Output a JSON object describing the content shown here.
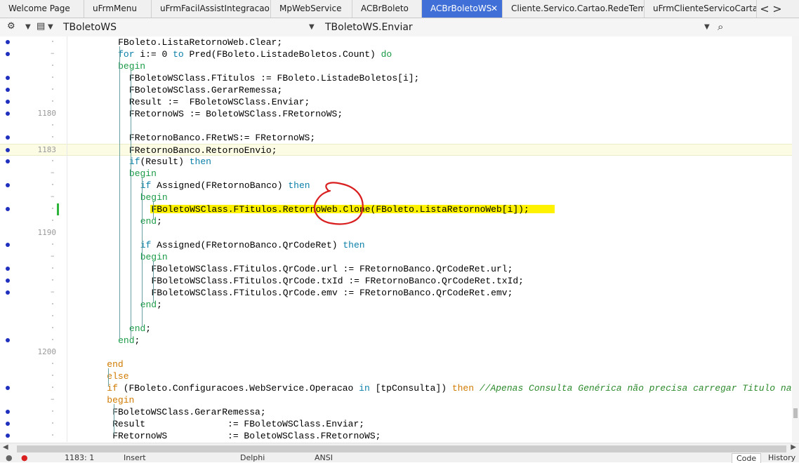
{
  "tabs": [
    {
      "label": "Welcome Page"
    },
    {
      "label": "uFrmMenu"
    },
    {
      "label": "uFrmFacilAssistIntegracao"
    },
    {
      "label": "MpWebService"
    },
    {
      "label": "ACBrBoleto"
    },
    {
      "label": "ACBrBoletoWS",
      "active": true
    },
    {
      "label": "Cliente.Servico.Cartao.RedeTem"
    },
    {
      "label": "uFrmClienteServicoCartaoC"
    }
  ],
  "tab_close_glyph": "✕",
  "tab_nav": {
    "prev": "<",
    "next": ">"
  },
  "toolbar": {
    "class_combo": "TBoletoWS",
    "method_combo": "TBoletoWS.Enviar"
  },
  "icons": [
    "settings-icon",
    "dropdown-arrow-icon",
    "structure-icon",
    "search-icon",
    "breakpoint-icon",
    "close-icon"
  ],
  "colors": {
    "active_tab": "#3f6fd7",
    "keyword_orange": "#d07a00",
    "keyword_blue": "#0a7fa8",
    "keyword_green": "#1a9a46",
    "comment_green": "#2d8a2d",
    "highlight_yellow": "#fff200",
    "annotation_red": "#d91f1f",
    "breakpoint_blue": "#1f2fbe"
  },
  "editor": {
    "lines": [
      {
        "num": "",
        "bp": true,
        "mark": "dot",
        "indent": 9,
        "tokens": [
          [
            "FBoleto.ListaRetornoWeb.Clear;",
            ""
          ]
        ]
      },
      {
        "num": "",
        "bp": true,
        "mark": "dash",
        "indent": 9,
        "tokens": [
          [
            "for",
            "kw2"
          ],
          [
            " i:= ",
            ""
          ],
          [
            "0",
            ""
          ],
          [
            " to ",
            "kw2"
          ],
          [
            "Pred(FBoleto.ListadeBoletos.Count) ",
            ""
          ],
          [
            "do",
            "kw3"
          ]
        ]
      },
      {
        "num": "",
        "bp": false,
        "mark": "dot",
        "indent": 9,
        "tokens": [
          [
            "begin",
            "kw3"
          ]
        ]
      },
      {
        "num": "",
        "bp": true,
        "mark": "dot",
        "indent": 11,
        "tokens": [
          [
            "FBoletoWSClass.FTitulos := FBoleto.ListadeBoletos[i];",
            ""
          ]
        ]
      },
      {
        "num": "",
        "bp": true,
        "mark": "dot",
        "indent": 11,
        "tokens": [
          [
            "FBoletoWSClass.GerarRemessa;",
            ""
          ]
        ]
      },
      {
        "num": "",
        "bp": true,
        "mark": "dot",
        "indent": 11,
        "tokens": [
          [
            "Result :=  FBoletoWSClass.Enviar;",
            ""
          ]
        ]
      },
      {
        "num": "1180",
        "bp": true,
        "mark": "",
        "indent": 11,
        "tokens": [
          [
            "FRetornoWS := BoletoWSClass.FRetornoWS;",
            ""
          ]
        ]
      },
      {
        "num": "",
        "bp": false,
        "mark": "dot",
        "indent": 0,
        "tokens": []
      },
      {
        "num": "",
        "bp": true,
        "mark": "dot",
        "indent": 11,
        "tokens": [
          [
            "FRetornoBanco.FRetWS:= FRetornoWS;",
            ""
          ]
        ]
      },
      {
        "num": "1183",
        "bp": true,
        "mark": "",
        "indent": 11,
        "current": true,
        "tokens": [
          [
            "FRetornoBanco.RetornoEnvio;",
            ""
          ]
        ]
      },
      {
        "num": "",
        "bp": true,
        "mark": "dot",
        "indent": 11,
        "tokens": [
          [
            "if",
            "kw2"
          ],
          [
            "(Result) ",
            ""
          ],
          [
            "then",
            "kw2"
          ]
        ]
      },
      {
        "num": "",
        "bp": false,
        "mark": "dash",
        "indent": 11,
        "tokens": [
          [
            "begin",
            "kw3"
          ]
        ]
      },
      {
        "num": "",
        "bp": true,
        "mark": "dot",
        "indent": 13,
        "tokens": [
          [
            "if",
            "kw2"
          ],
          [
            " Assigned(FRetornoBanco) ",
            ""
          ],
          [
            "then",
            "kw2"
          ]
        ]
      },
      {
        "num": "",
        "bp": false,
        "mark": "dash",
        "indent": 13,
        "tokens": [
          [
            "begin",
            "kw3"
          ]
        ]
      },
      {
        "num": "",
        "bp": true,
        "mark": "dot",
        "indent": 15,
        "green": true,
        "highlight": true,
        "tokens": [
          [
            "FBoletoWSClass.FTitulos.RetornoWeb.Clone(FBoleto.ListaRetornoWeb[i]);",
            ""
          ]
        ]
      },
      {
        "num": "",
        "bp": false,
        "mark": "dot",
        "indent": 13,
        "tokens": [
          [
            "end",
            "kw3"
          ],
          [
            ";",
            ""
          ]
        ]
      },
      {
        "num": "1190",
        "bp": false,
        "mark": "",
        "indent": 0,
        "tokens": []
      },
      {
        "num": "",
        "bp": true,
        "mark": "dot",
        "indent": 13,
        "tokens": [
          [
            "if",
            "kw2"
          ],
          [
            " Assigned(FRetornoBanco.QrCodeRet) ",
            ""
          ],
          [
            "then",
            "kw2"
          ]
        ]
      },
      {
        "num": "",
        "bp": false,
        "mark": "dash",
        "indent": 13,
        "tokens": [
          [
            "begin",
            "kw3"
          ]
        ]
      },
      {
        "num": "",
        "bp": true,
        "mark": "dot",
        "indent": 15,
        "tokens": [
          [
            "FBoletoWSClass.FTitulos.QrCode.url := FRetornoBanco.QrCodeRet.url;",
            ""
          ]
        ]
      },
      {
        "num": "",
        "bp": true,
        "mark": "dot",
        "indent": 15,
        "tokens": [
          [
            "FBoletoWSClass.FTitulos.QrCode.txId := FRetornoBanco.QrCodeRet.txId;",
            ""
          ]
        ]
      },
      {
        "num": "",
        "bp": true,
        "mark": "dash",
        "indent": 15,
        "tokens": [
          [
            "FBoletoWSClass.FTitulos.QrCode.emv := FRetornoBanco.QrCodeRet.emv;",
            ""
          ]
        ]
      },
      {
        "num": "",
        "bp": false,
        "mark": "dot",
        "indent": 13,
        "tokens": [
          [
            "end",
            "kw3"
          ],
          [
            ";",
            ""
          ]
        ]
      },
      {
        "num": "",
        "bp": false,
        "mark": "dot",
        "indent": 0,
        "tokens": []
      },
      {
        "num": "",
        "bp": false,
        "mark": "dot",
        "indent": 11,
        "tokens": [
          [
            "end",
            "kw3"
          ],
          [
            ";",
            ""
          ]
        ]
      },
      {
        "num": "",
        "bp": true,
        "mark": "dot",
        "indent": 9,
        "tokens": [
          [
            "end",
            "kw3"
          ],
          [
            ";",
            ""
          ]
        ]
      },
      {
        "num": "1200",
        "bp": false,
        "mark": "",
        "indent": 0,
        "tokens": []
      },
      {
        "num": "",
        "bp": false,
        "mark": "dot",
        "indent": 7,
        "tokens": [
          [
            "end",
            "kw"
          ]
        ]
      },
      {
        "num": "",
        "bp": false,
        "mark": "dot",
        "indent": 7,
        "tokens": [
          [
            "else",
            "kw"
          ]
        ]
      },
      {
        "num": "",
        "bp": true,
        "mark": "dot",
        "indent": 7,
        "tokens": [
          [
            "if",
            "kw"
          ],
          [
            " (FBoleto.Configuracoes.WebService.Operacao ",
            ""
          ],
          [
            "in",
            "kw2"
          ],
          [
            " [tpConsulta]) ",
            ""
          ],
          [
            "then",
            "kw"
          ],
          [
            " ",
            ""
          ],
          [
            "//Apenas Consulta Genérica não precisa carregar Titulo na L",
            "comment"
          ]
        ]
      },
      {
        "num": "",
        "bp": false,
        "mark": "dash",
        "indent": 7,
        "tokens": [
          [
            "begin",
            "kw"
          ]
        ]
      },
      {
        "num": "",
        "bp": true,
        "mark": "dot",
        "indent": 8,
        "tokens": [
          [
            "FBoletoWSClass.GerarRemessa;",
            ""
          ]
        ]
      },
      {
        "num": "",
        "bp": true,
        "mark": "dot",
        "indent": 8,
        "tokens": [
          [
            "Result               := FBoletoWSClass.Enviar;",
            ""
          ]
        ]
      },
      {
        "num": "",
        "bp": true,
        "mark": "dot",
        "indent": 8,
        "tokens": [
          [
            "FRetornoWS           := BoletoWSClass.FRetornoWS;",
            ""
          ]
        ]
      }
    ]
  },
  "statusbar": {
    "position": "1183: 1",
    "mode": "Insert",
    "modified": "Delphi",
    "encoding": "ANSI",
    "code_tab": "Code",
    "history_tab": "History"
  }
}
